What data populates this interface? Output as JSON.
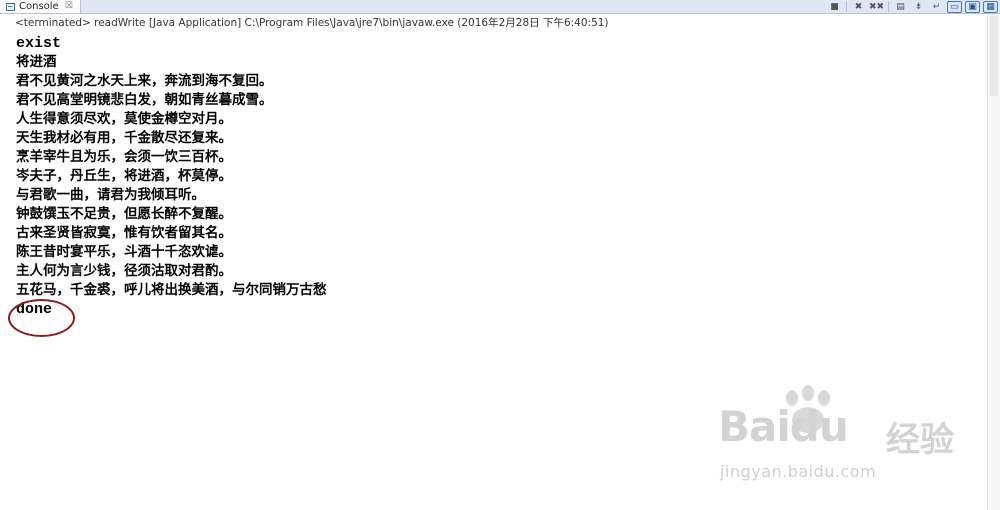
{
  "tab": {
    "label": "Console",
    "close": "☒"
  },
  "toolbar": {
    "buttons": [
      {
        "name": "terminate-icon",
        "glyph": "■"
      },
      {
        "name": "remove-launch-icon",
        "glyph": "✖"
      },
      {
        "name": "remove-all-icon",
        "glyph": "✖✖"
      },
      {
        "name": "clear-console-icon",
        "glyph": "▤"
      },
      {
        "name": "scroll-lock-icon",
        "glyph": "⇟"
      },
      {
        "name": "word-wrap-icon",
        "glyph": "↵"
      },
      {
        "name": "pin-console-icon",
        "glyph": "▭"
      },
      {
        "name": "display-selected-console-icon",
        "glyph": "▣"
      },
      {
        "name": "open-console-icon",
        "glyph": "▦"
      }
    ]
  },
  "status": "<terminated> readWrite [Java Application] C:\\Program Files\\Java\\jre7\\bin\\javaw.exe (2016年2月28日 下午6:40:51)",
  "console": {
    "first": "exist",
    "lines": [
      "将进酒",
      "君不见黄河之水天上来，奔流到海不复回。",
      "君不见高堂明镜悲白发，朝如青丝暮成雪。",
      "人生得意须尽欢，莫使金樽空对月。",
      "天生我材必有用，千金散尽还复来。",
      "烹羊宰牛且为乐，会须一饮三百杯。",
      "岑夫子，丹丘生，将进酒，杯莫停。",
      "与君歌一曲，请君为我倾耳听。",
      "钟鼓馔玉不足贵，但愿长醉不复醒。",
      "古来圣贤皆寂寞，惟有饮者留其名。",
      "陈王昔时宴平乐，斗酒十千恣欢谑。",
      "主人何为言少钱，径须沽取对君酌。",
      "五花马，千金裘，呼儿将出换美酒，与尔同销万古愁"
    ],
    "last": "done"
  },
  "watermark": {
    "logo": "Baidu",
    "cn": "经验",
    "url": "jingyan.baidu.com"
  },
  "colors": {
    "annotation": "#8c1a1a",
    "tabbar": "#dfe7f3"
  }
}
